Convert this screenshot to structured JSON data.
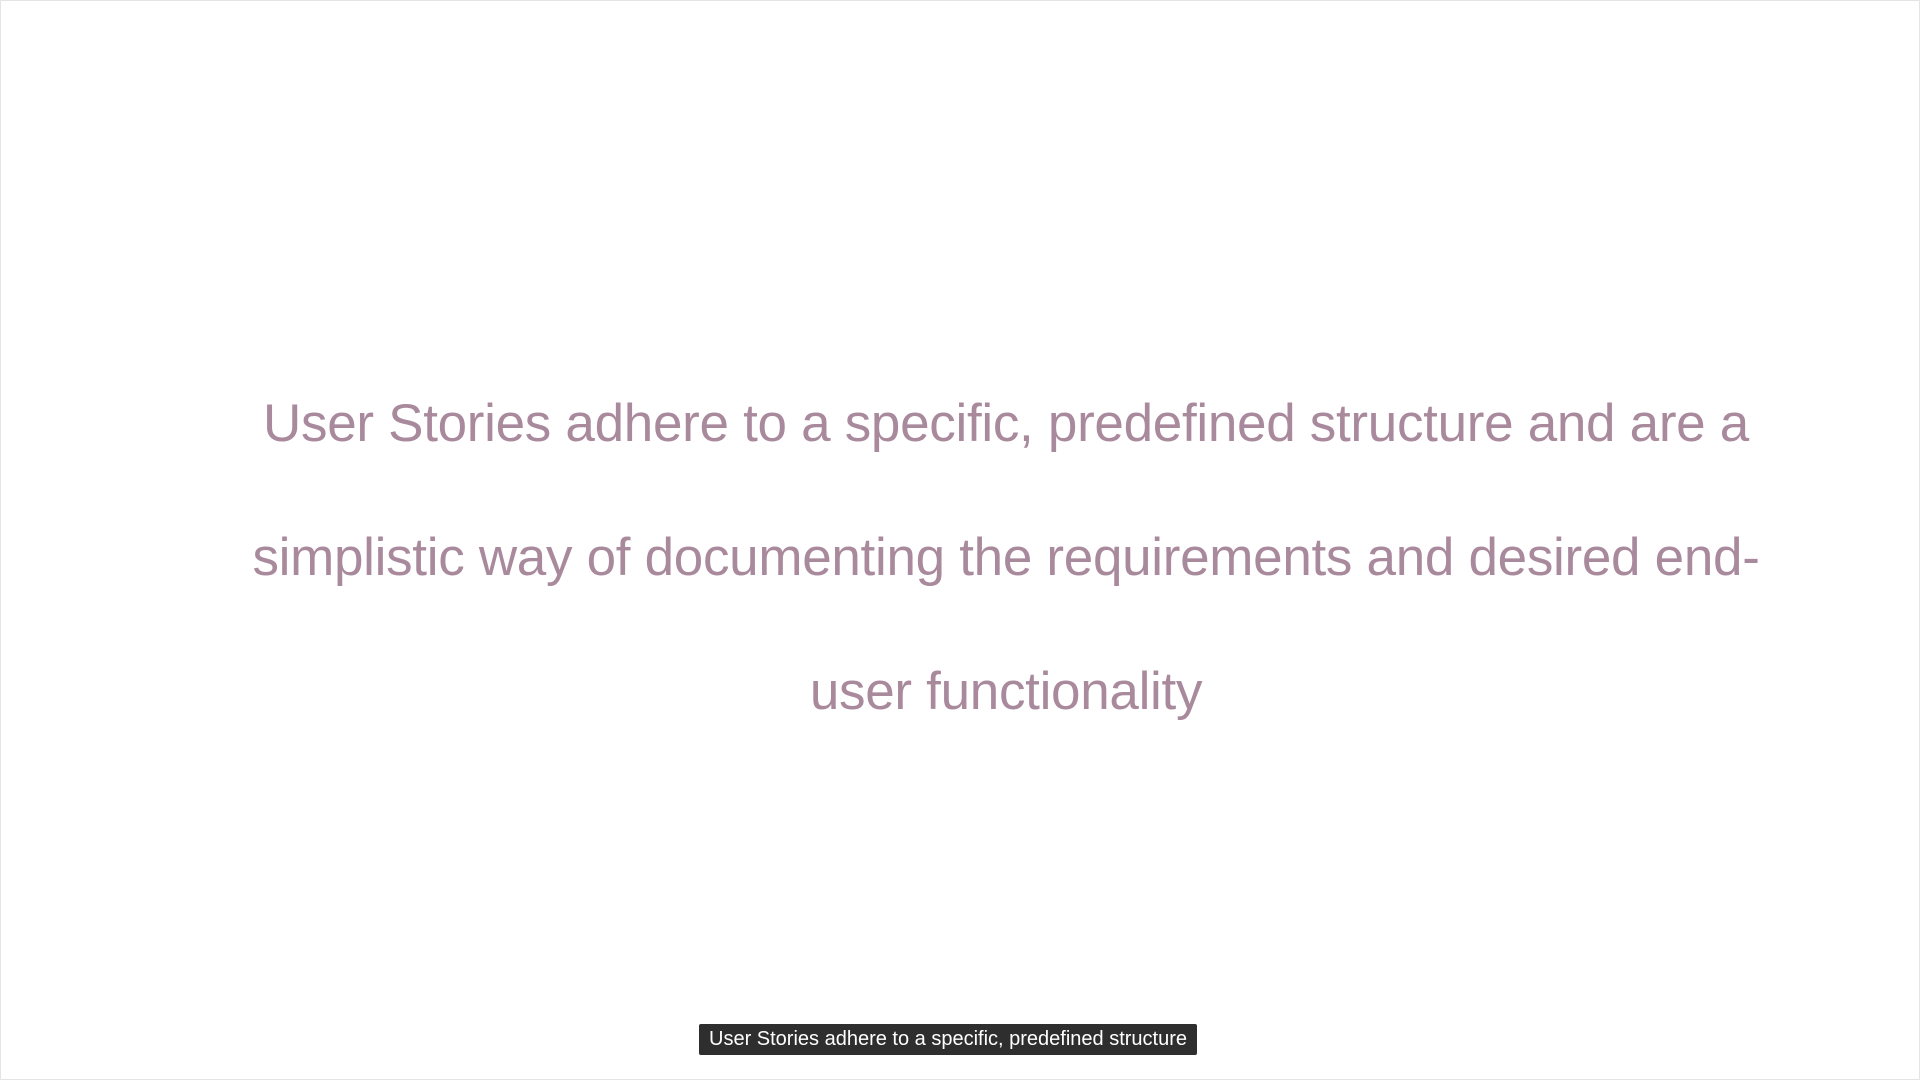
{
  "slide": {
    "lines": [
      "User Stories adhere to a specific, predefined structure and are a",
      "simplistic way of documenting the requirements and desired end-",
      "user functionality"
    ],
    "text_color": "#a98a9d"
  },
  "caption": {
    "text": "User Stories adhere to a specific, predefined structure"
  }
}
